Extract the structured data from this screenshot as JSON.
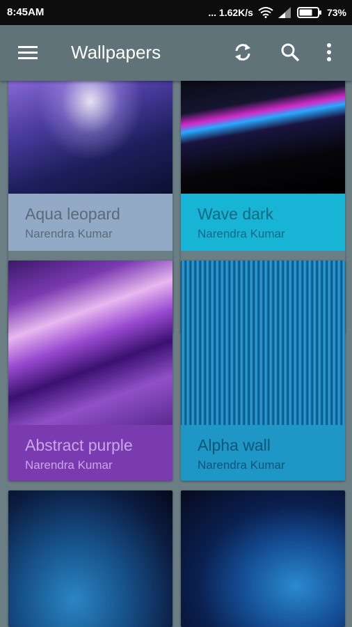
{
  "status_bar": {
    "time": "8:45AM",
    "network_speed": "... 1.62K/s",
    "battery": "73%"
  },
  "app_bar": {
    "title": "Wallpapers",
    "icons": [
      "menu-icon",
      "refresh-icon",
      "search-icon",
      "more-vert-icon"
    ]
  },
  "wallpapers": [
    {
      "name": "Aqua leopard",
      "author": "Narendra Kumar"
    },
    {
      "name": "Wave dark",
      "author": "Narendra Kumar"
    },
    {
      "name": "Abstract purple",
      "author": "Narendra Kumar"
    },
    {
      "name": "Alpha wall",
      "author": "Narendra Kumar"
    },
    {
      "name": "",
      "author": ""
    },
    {
      "name": "",
      "author": ""
    }
  ]
}
